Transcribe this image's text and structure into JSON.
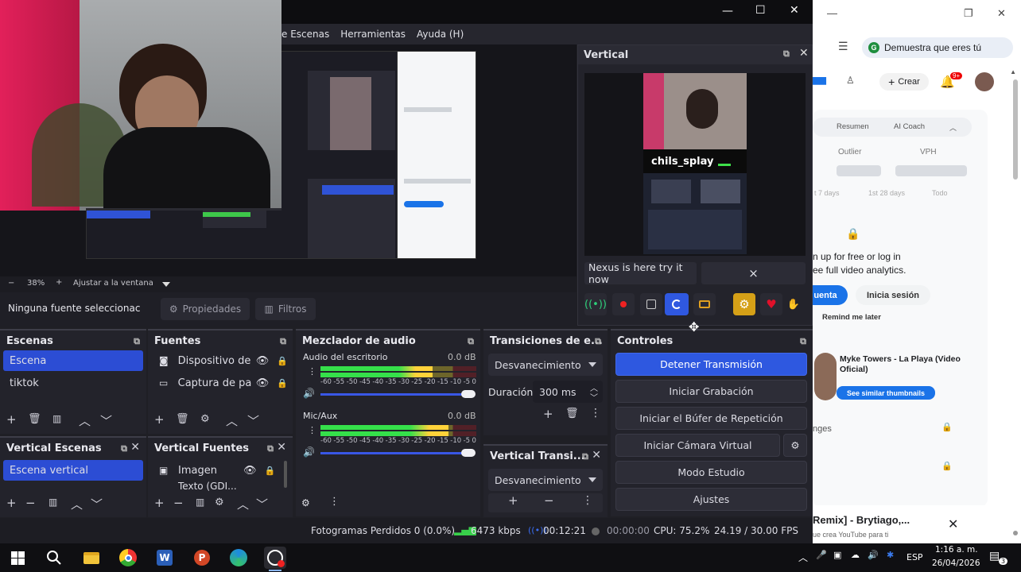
{
  "obs": {
    "menu": [
      "e Escenas",
      "Herramientas",
      "Ayuda (H)"
    ],
    "window_controls": [
      "—",
      "☐",
      "✕"
    ],
    "zoom": {
      "minus": "−",
      "value": "38%",
      "plus": "+",
      "fit_label": "Ajustar a la ventana"
    },
    "source_bar": {
      "none_selected": "Ninguna fuente seleccionac",
      "properties": "Propiedades",
      "filters": "Filtros"
    },
    "vertical_dock": {
      "title": "Vertical",
      "overlay_name": "chils_splay",
      "banner_text": "Nexus is here try it now",
      "banner_close": "×"
    },
    "scenes": {
      "title": "Escenas",
      "items": [
        "Escena",
        "tiktok"
      ]
    },
    "sources": {
      "title": "Fuentes",
      "items": [
        "Dispositivo de ca",
        "Captura de pant"
      ]
    },
    "mixer": {
      "title": "Mezclador de audio",
      "channels": [
        {
          "name": "Audio del escritorio",
          "db": "0.0 dB",
          "level": 0.72
        },
        {
          "name": "Mic/Aux",
          "db": "0.0 dB",
          "level": 0.82
        }
      ],
      "ticks": [
        "-60",
        "-55",
        "-50",
        "-45",
        "-40",
        "-35",
        "-30",
        "-25",
        "-20",
        "-15",
        "-10",
        "-5",
        "0"
      ]
    },
    "transitions": {
      "title": "Transiciones de e...",
      "type": "Desvanecimiento",
      "duration_label": "Duración",
      "duration_value": "300 ms"
    },
    "controls": {
      "title": "Controles",
      "buttons": [
        "Detener Transmisión",
        "Iniciar Grabación",
        "Iniciar el Búfer de Repetición",
        "Iniciar Cámara Virtual",
        "Modo Estudio",
        "Ajustes"
      ]
    },
    "vertical_scenes": {
      "title": "Vertical Escenas",
      "items": [
        "Escena vertical"
      ]
    },
    "vertical_sources": {
      "title": "Vertical Fuentes",
      "items": [
        "Imagen",
        "Texto (GDI..."
      ]
    },
    "vertical_transitions": {
      "title": "Vertical Transi...",
      "type": "Desvanecimiento"
    },
    "status": {
      "dropped": "Fotogramas Perdidos 0 (0.0%)",
      "bitrate": "6473 kbps",
      "stream_time": "00:12:21",
      "rec_time": "00:00:00",
      "cpu": "CPU: 75.2%",
      "fps": "24.19 / 30.00 FPS"
    }
  },
  "browser": {
    "verify_pill": "Demuestra que eres tú",
    "create": "Crear",
    "notif_count": "9+",
    "tabs": [
      "Resumen",
      "AI Coach"
    ],
    "metrics": [
      "Outlier",
      "VPH"
    ],
    "ranges": [
      "t 7 days",
      "1st 28 days",
      "Todo"
    ],
    "signup_text": "n up for free or log in",
    "signup_text2": "ee full video analytics.",
    "btn_account": "uenta",
    "btn_login": "Inicia sesión",
    "remind": "Remind me later",
    "video_title": "Myke Towers - La Playa (Video Oficial)",
    "similar": "See similar thumbnails",
    "locked1": "nges",
    "bottom_title": "Remix] - Brytiago,...",
    "bottom_sub": "ue crea YouTube para ti"
  },
  "taskbar": {
    "lang": "ESP",
    "time": "1:16 a. m.",
    "date": "26/04/2026",
    "notif": "3"
  }
}
